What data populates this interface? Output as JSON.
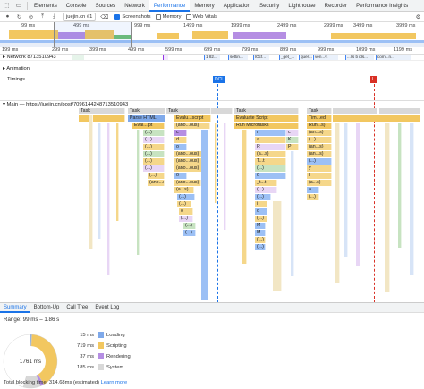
{
  "devtools": {
    "tabs": [
      "Elements",
      "Console",
      "Sources",
      "Network",
      "Performance",
      "Memory",
      "Application",
      "Security",
      "Lighthouse",
      "Recorder",
      "Performance insights"
    ],
    "active_tab": "Performance"
  },
  "toolbar": {
    "profile_select": "juejin.cn #1",
    "screenshots_label": "Screenshots",
    "memory_label": "Memory",
    "webvitals_label": "Web Vitals",
    "screenshots_checked": true
  },
  "overview": {
    "ticks": [
      "99 ms",
      "499 ms",
      "999 ms",
      "1499 ms",
      "1999 ms",
      "2499 ms",
      "2999 ms",
      "3499 ms",
      "3999 ms"
    ]
  },
  "ruler": {
    "ticks": [
      "199 ms",
      "299 ms",
      "399 ms",
      "499 ms",
      "599 ms",
      "699 ms",
      "799 ms",
      "899 ms",
      "999 ms",
      "1099 ms",
      "1199 ms"
    ]
  },
  "tracks": {
    "network": "▸ Network 8713510943",
    "animation": "▸ Animation",
    "timings": "Timings",
    "main": "▾ Main — https://juejin.cn/post/7096144248713510943"
  },
  "network_chips": [
    "1 82...",
    "settin...",
    "lOcf...",
    "_get_...",
    "quer...",
    "ven...v.",
    "...lis b ids...",
    "com...n..."
  ],
  "markers": {
    "dcl": "DCL",
    "load": "L"
  },
  "flame": {
    "task": "Task",
    "parse_html": "Parse HTML",
    "evaluate_script": "Evaluate Script",
    "evalu_script": "Evalu...script",
    "run_microtasks": "Run Microtasks",
    "eval_ipt": "Eval...ipt",
    "anonymous": "(ano...ous)",
    "an_s": "(an...s)",
    "run_s": "Run...s)",
    "tim_ed": "Tim...ed",
    "dots": "(...)",
    "c": "c",
    "d": "d",
    "o": "o",
    "r": "r",
    "a": "a",
    "R": "R",
    "K": "K",
    "P": "P",
    "M": "M",
    "t_t": "_t...t",
    "y": "y",
    "i": "i",
    "a_s": "(a...s)",
    "T_t": "T...t"
  },
  "bottom_tabs": [
    "Summary",
    "Bottom-Up",
    "Call Tree",
    "Event Log"
  ],
  "range": "Range: 99 ms – 1.86 s",
  "summary": {
    "total": "1761 ms",
    "items": [
      {
        "ms": "15 ms",
        "label": "Loading",
        "color": "#7fa9ea",
        "value": 15
      },
      {
        "ms": "719 ms",
        "label": "Scripting",
        "color": "#f2c760",
        "value": 719
      },
      {
        "ms": "37 ms",
        "label": "Rendering",
        "color": "#b58ee3",
        "value": 37
      },
      {
        "ms": "185 ms",
        "label": "System",
        "color": "#d8d8d8",
        "value": 185
      },
      {
        "ms": "805 ms",
        "label": "Idle",
        "color": "#ffffff",
        "value": 805
      }
    ]
  },
  "blocking": {
    "text": "Total blocking time: 314.68ms (estimated)",
    "link": "Learn more"
  }
}
